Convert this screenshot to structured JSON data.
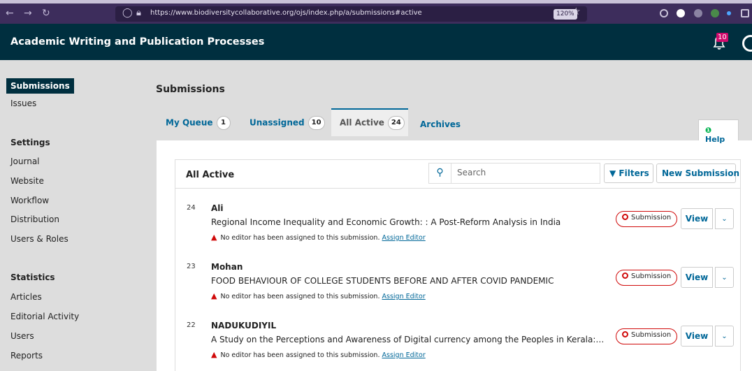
{
  "browser": {
    "url": "https://www.biodiversitycollaborative.org/ojs/index.php/a/submissions#active",
    "zoom": "120%"
  },
  "app": {
    "title": "Academic Writing and Publication Processes",
    "notification_count": "10"
  },
  "sidebar": {
    "items": [
      {
        "label": "Submissions"
      },
      {
        "label": "Issues"
      }
    ],
    "settings_heading": "Settings",
    "settings": [
      {
        "label": "Journal"
      },
      {
        "label": "Website"
      },
      {
        "label": "Workflow"
      },
      {
        "label": "Distribution"
      },
      {
        "label": "Users & Roles"
      }
    ],
    "statistics_heading": "Statistics",
    "statistics": [
      {
        "label": "Articles"
      },
      {
        "label": "Editorial Activity"
      },
      {
        "label": "Users"
      },
      {
        "label": "Reports"
      }
    ]
  },
  "main": {
    "page_title": "Submissions",
    "tabs": [
      {
        "label": "My Queue",
        "count": "1"
      },
      {
        "label": "Unassigned",
        "count": "10"
      },
      {
        "label": "All Active",
        "count": "24"
      },
      {
        "label": "Archives"
      }
    ],
    "help_label": "Help",
    "list": {
      "title": "All Active",
      "search_placeholder": "Search",
      "filters_label": "Filters",
      "new_submission_label": "New Submission",
      "warning_text": "No editor has been assigned to this submission.",
      "assign_label": "Assign Editor",
      "stage_label": "Submission",
      "view_label": "View",
      "rows": [
        {
          "id": "24",
          "author": "Ali",
          "title": "Regional Income Inequality and Economic Growth: : A Post-Reform Analysis in India"
        },
        {
          "id": "23",
          "author": "Mohan",
          "title": "FOOD BEHAVIOUR OF COLLEGE STUDENTS BEFORE AND AFTER COVID PANDEMIC"
        },
        {
          "id": "22",
          "author": "NADUKUDIYIL",
          "title": "A Study on the Perceptions and Awareness of Digital currency among the Peoples in Kerala: Perc..."
        }
      ]
    }
  },
  "colors": {
    "header_bg": "#002f3f",
    "link": "#006798",
    "stage_border": "#d00a0a",
    "notification": "#d00a6c"
  }
}
